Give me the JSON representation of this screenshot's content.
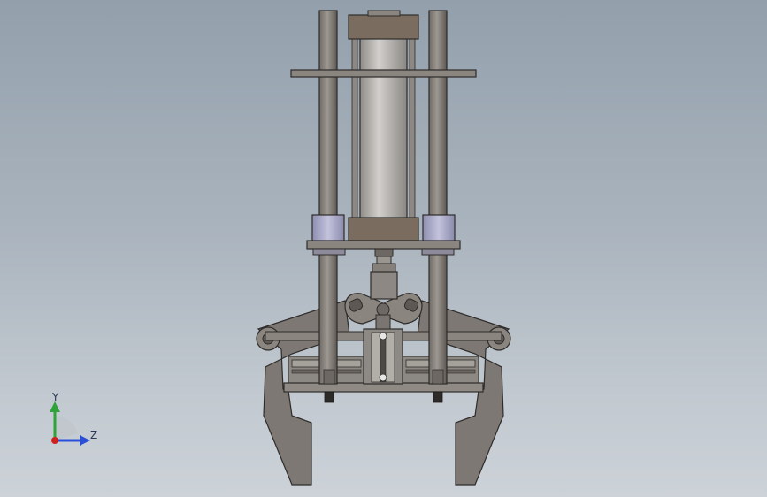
{
  "viewport": {
    "background_top": "#93a0ac",
    "background_bottom": "#ccd2d8"
  },
  "model": {
    "description": "",
    "colors": {
      "metal": "#7e7872",
      "metal_dark": "#5f5a55",
      "metal_light": "#a7a29c",
      "cylinder": "#b9b7b3",
      "bushing": "#a9a9c8",
      "outline": "#2e2c2a"
    }
  },
  "triad": {
    "y_label": "Y",
    "z_label": "Z",
    "y_color": "#2fa33a",
    "z_color": "#2a4fd6",
    "x_color": "#d02020"
  }
}
